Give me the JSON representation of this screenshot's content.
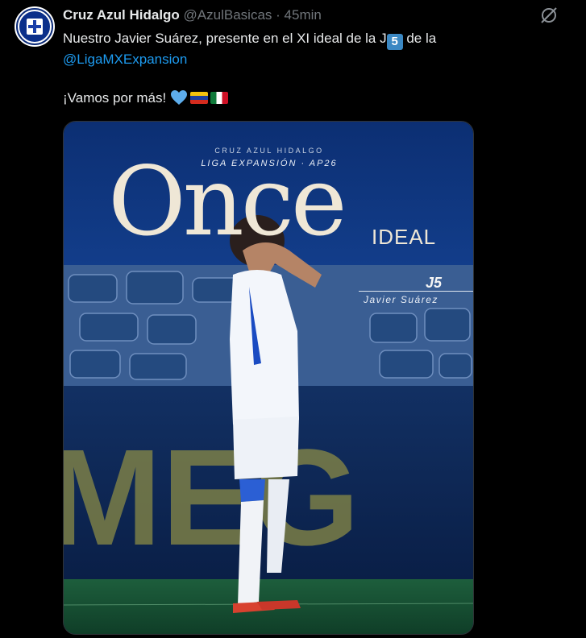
{
  "author": {
    "name": "Cruz Azul Hidalgo",
    "handle": "@AzulBasicas",
    "separator": "·",
    "time": "45min"
  },
  "tweet": {
    "text_part1": "Nuestro Javier Suárez, presente en el XI ideal de la J",
    "keycap": "5",
    "text_part2": " de la",
    "mention": "@LigaMXExpansion",
    "line3": "¡Vamos por más!"
  },
  "graphic": {
    "kicker_club": "CRUZ AZUL HIDALGO",
    "kicker_league": "LIGA EXPANSIÓN · AP26",
    "title_big": "Once",
    "title_small": "IDEAL",
    "round": "J5",
    "player_name": "Javier Suárez",
    "background_text": "MEG"
  },
  "colors": {
    "background": "#000000",
    "text": "#e7e9ea",
    "muted": "#71767b",
    "link": "#1d9bf0",
    "graphic_blue": "#0f3e8c"
  },
  "icons": {
    "grok": "grok-icon",
    "heart": "blue-heart-emoji",
    "flag1": "venezuela-flag",
    "flag2": "mexico-flag"
  }
}
